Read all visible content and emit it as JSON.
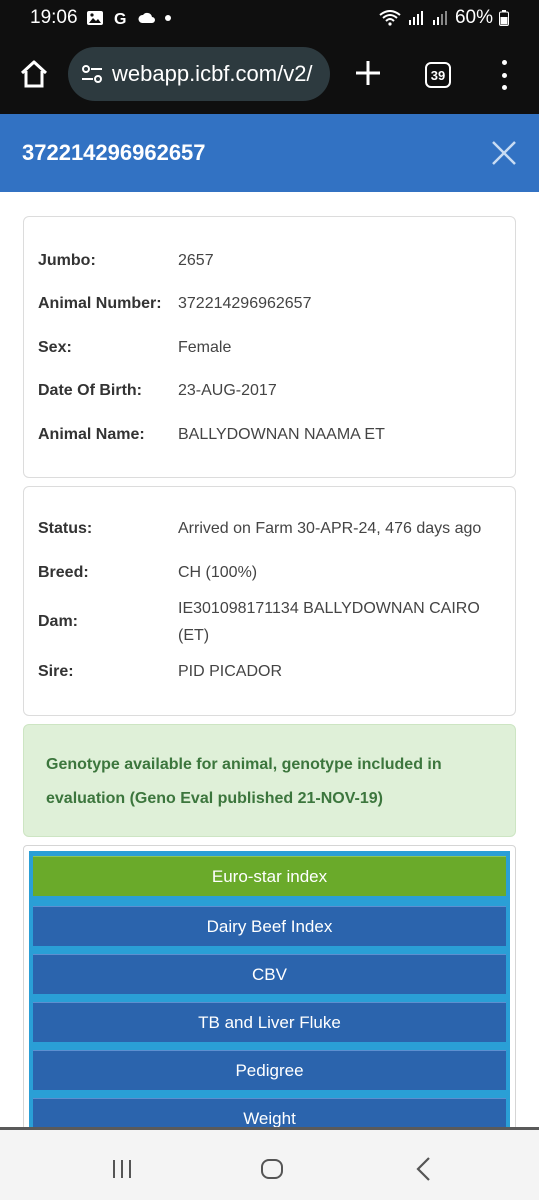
{
  "status_bar": {
    "time": "19:06",
    "battery": "60%"
  },
  "browser": {
    "url": "webapp.icbf.com/v2/",
    "tab_count": "39"
  },
  "header": {
    "title": "372214296962657"
  },
  "identity": [
    {
      "label": "Jumbo:",
      "value": "2657"
    },
    {
      "label": "Animal Number:",
      "value": "372214296962657"
    },
    {
      "label": "Sex:",
      "value": "Female"
    },
    {
      "label": "Date Of Birth:",
      "value": "23-AUG-2017"
    },
    {
      "label": "Animal Name:",
      "value": "BALLYDOWNAN NAAMA ET"
    }
  ],
  "details": [
    {
      "label": "Status:",
      "value": "Arrived on Farm 30-APR-24, 476 days ago"
    },
    {
      "label": "Breed:",
      "value": "CH (100%)"
    },
    {
      "label": "Dam:",
      "value": "IE301098171134 BALLYDOWNAN CAIRO (ET)"
    },
    {
      "label": "Sire:",
      "value": "PID PICADOR"
    }
  ],
  "genotype_notice": "Genotype available for animal, genotype included in evaluation (Geno Eval published 21-NOV-19)",
  "menu": [
    {
      "label": "Euro-star index",
      "active": true
    },
    {
      "label": "Dairy Beef Index",
      "active": false
    },
    {
      "label": "CBV",
      "active": false
    },
    {
      "label": "TB and Liver Fluke",
      "active": false
    },
    {
      "label": "Pedigree",
      "active": false
    },
    {
      "label": "Weight",
      "active": false
    }
  ],
  "colors": {
    "header_blue": "#3272c3",
    "menu_blue": "#2b64ad",
    "menu_active_green": "#6aaa2a",
    "notice_bg": "#dff0d8",
    "notice_text": "#3c763d"
  }
}
